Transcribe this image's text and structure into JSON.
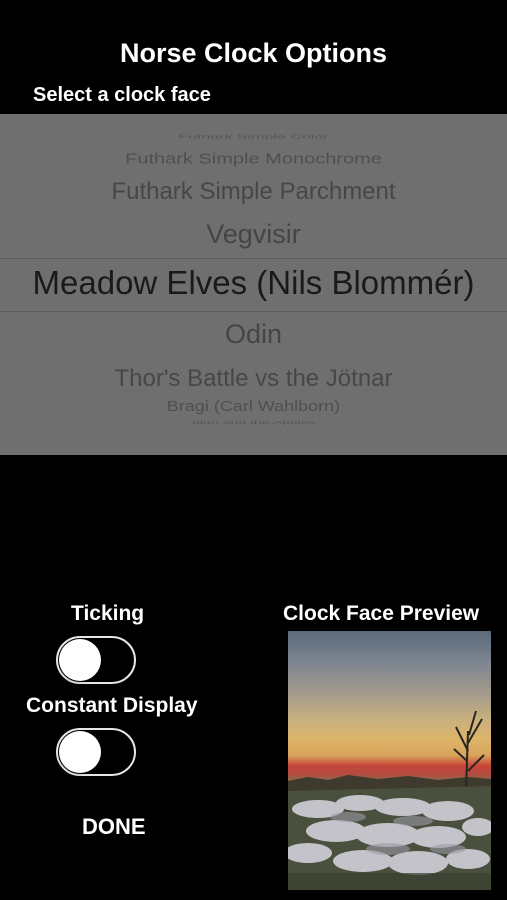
{
  "header": {
    "title": "Norse Clock Options",
    "subtitle": "Select a clock face"
  },
  "picker": {
    "items": [
      "Futhark Simple Color",
      "Futhark Simple Monochrome",
      "Futhark Simple Parchment",
      "Vegvisir",
      "Meadow Elves (Nils Blommér)",
      "Odin",
      "Thor's Battle vs the Jötnar",
      "Bragi (Carl Wahlborn)",
      "Idun and the Apples"
    ],
    "selected_index": 4
  },
  "ticking": {
    "label": "Ticking",
    "on": false
  },
  "constant_display": {
    "label": "Constant Display",
    "on": false
  },
  "done_label": "DONE",
  "preview": {
    "label": "Clock Face Preview"
  }
}
